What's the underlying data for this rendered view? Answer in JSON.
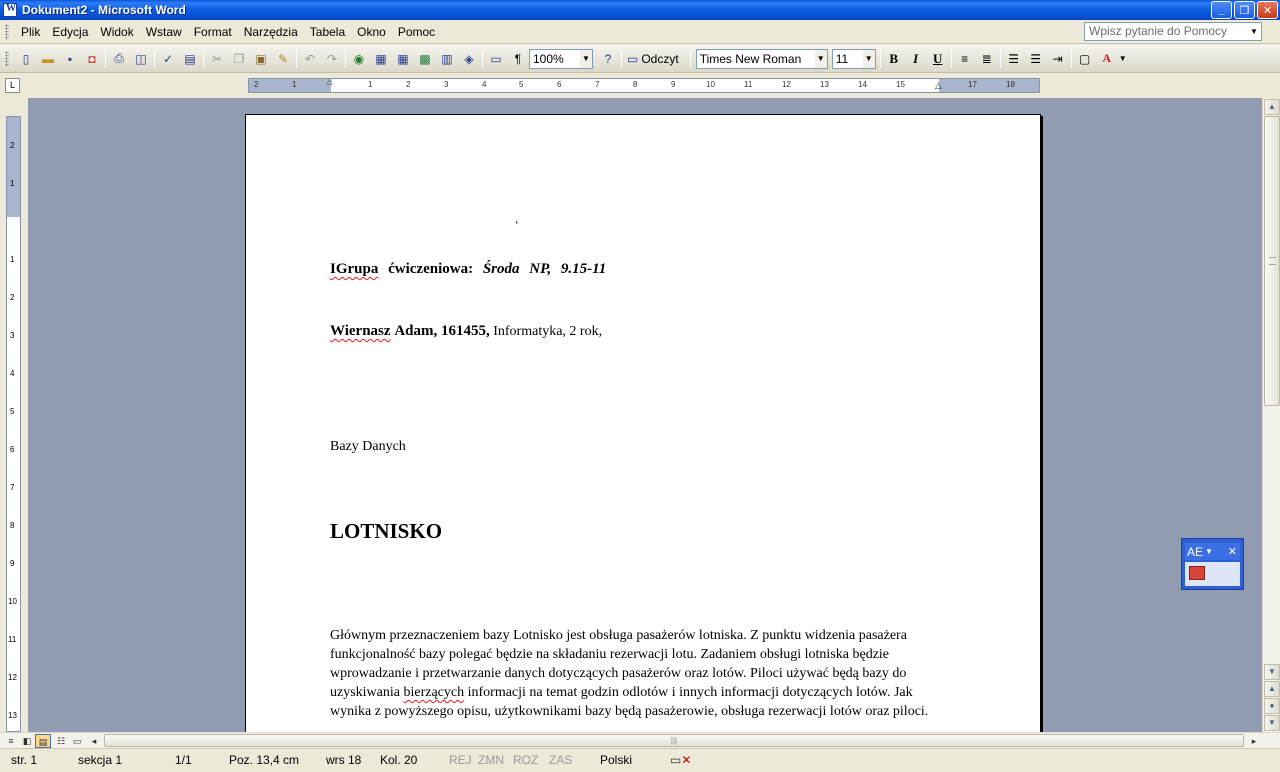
{
  "window": {
    "title": "Dokument2 - Microsoft Word",
    "buttons": [
      "_",
      "❐",
      "✕"
    ]
  },
  "menu": {
    "items": [
      "Plik",
      "Edycja",
      "Widok",
      "Wstaw",
      "Format",
      "Narzędzia",
      "Tabela",
      "Okno",
      "Pomoc"
    ],
    "help_placeholder": "Wpisz pytanie do Pomocy"
  },
  "toolbar": {
    "zoom": "100%",
    "read_label": "Odczyt",
    "font_name": "Times New Roman",
    "font_size": "11",
    "bold": "B",
    "italic": "I",
    "underline": "U"
  },
  "ruler": {
    "labels": [
      "2",
      "1",
      "1",
      "1",
      "2",
      "3",
      "4",
      "5",
      "6",
      "7",
      "8",
      "9",
      "10",
      "11",
      "12",
      "13",
      "14",
      "15",
      "16",
      "17",
      "18"
    ],
    "vlabels": [
      "2",
      "1",
      "1",
      "1",
      "2",
      "3",
      "4",
      "5",
      "6",
      "7",
      "8",
      "9",
      "10",
      "11",
      "12",
      "13"
    ]
  },
  "document": {
    "mark": "‘",
    "line1_a": "IGrupa",
    "line1_b": "ćwiczeniowa:",
    "line1_c": "Środa   NP,   9.15-11",
    "line2_a": "Wiernasz",
    "line2_b": "Adam, 161455,",
    "line2_c": " Informatyka, 2 rok,",
    "subject": "Bazy Danych",
    "heading": "LOTNISKO",
    "para_1": "Głównym przeznaczeniem bazy Lotnisko jest obsługa pasażerów lotniska. Z punktu widzenia pasażera funkcjonalność bazy polegać będzie na składaniu rezerwacji lotu. Zadaniem obsługi lotniska będzie wprowadzanie i przetwarzanie danych dotyczących pasażerów oraz lotów. Piloci używać będą bazy do uzyskiwania ",
    "para_squig": "bierzących",
    "para_2": " informacji na temat godzin odlotów i innych informacji dotyczących lotów. Jak wynika z powyższego opisu, użytkownikami bazy będą pasażerowie, obsługa rezerwacji lotów oraz piloci."
  },
  "status": {
    "page": "str. 1",
    "section": "sekcja  1",
    "pages": "1/1",
    "pos": "Poz.  13,4 cm",
    "line": "wrs  18",
    "col": "Kol.  20",
    "rej": "REJ",
    "zmn": "ZMN",
    "roz": "ROZ",
    "zas": "ZAS",
    "lang": "Polski"
  },
  "langbar": {
    "label": "AE"
  },
  "colors": {
    "title_blue": "#0a58e0",
    "workspace": "#919bb2",
    "spell_red": "#e01f1f"
  }
}
